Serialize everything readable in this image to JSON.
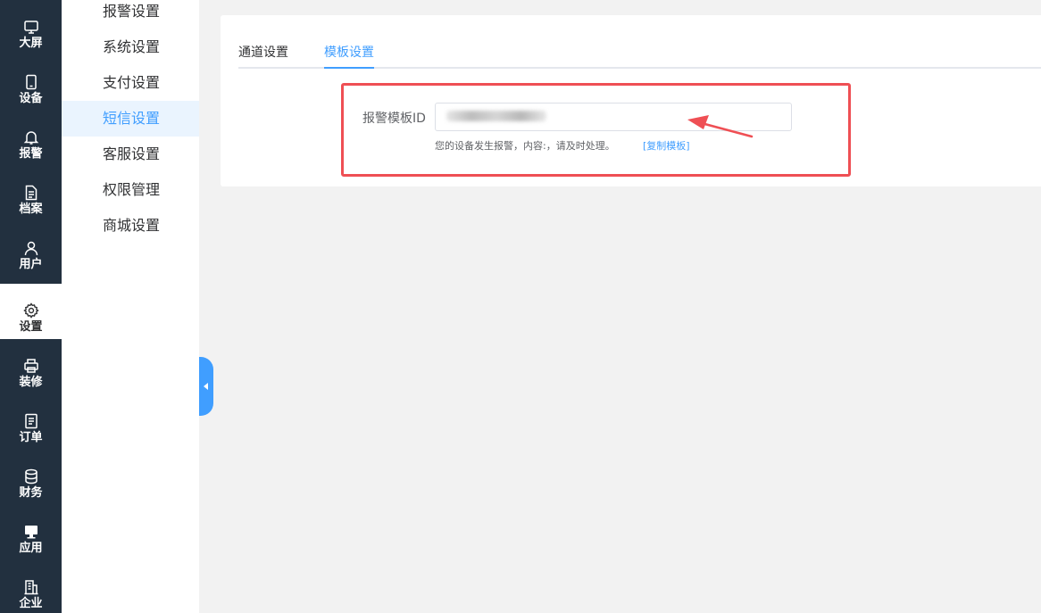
{
  "nav": [
    {
      "label": "大屏",
      "icon": "monitor-icon"
    },
    {
      "label": "设备",
      "icon": "phone-icon"
    },
    {
      "label": "报警",
      "icon": "bell-icon"
    },
    {
      "label": "档案",
      "icon": "document-icon"
    },
    {
      "label": "用户",
      "icon": "user-icon"
    },
    {
      "label": "设置",
      "icon": "gear-icon",
      "active": true
    },
    {
      "label": "装修",
      "icon": "printer-icon"
    },
    {
      "label": "订单",
      "icon": "order-list-icon"
    },
    {
      "label": "财务",
      "icon": "database-icon"
    },
    {
      "label": "应用",
      "icon": "desktop-icon"
    },
    {
      "label": "企业",
      "icon": "building-icon"
    }
  ],
  "submenu": [
    {
      "label": "报警设置"
    },
    {
      "label": "系统设置"
    },
    {
      "label": "支付设置"
    },
    {
      "label": "短信设置",
      "active": true
    },
    {
      "label": "客服设置"
    },
    {
      "label": "权限管理"
    },
    {
      "label": "商城设置"
    }
  ],
  "tabs": [
    {
      "label": "通道设置"
    },
    {
      "label": "模板设置",
      "active": true
    }
  ],
  "form": {
    "label": "报警模板ID",
    "value": "",
    "hint": "您的设备发生报警，内容:，请及时处理。",
    "copy_link": "[复制模板]"
  },
  "colors": {
    "nav_bg": "#22303f",
    "accent": "#409eff",
    "highlight": "#ef4f54"
  }
}
